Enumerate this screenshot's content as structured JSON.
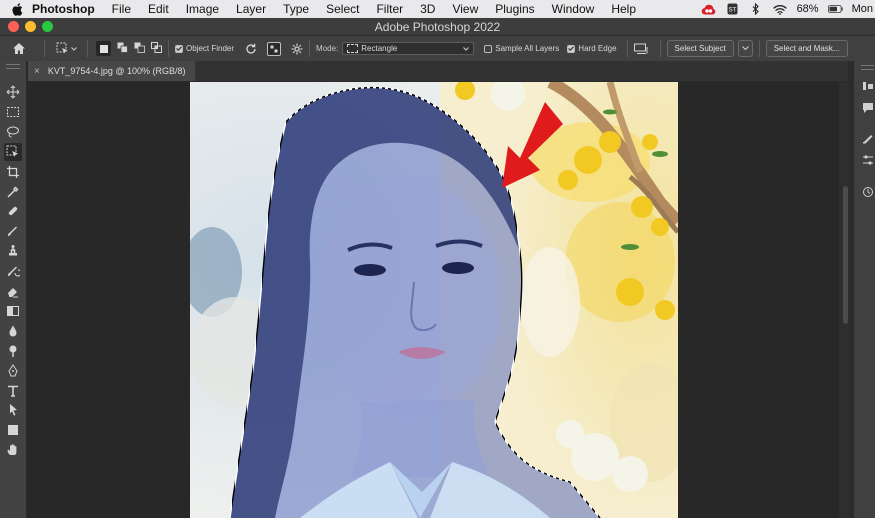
{
  "menubar": {
    "app": "Photoshop",
    "items": [
      "File",
      "Edit",
      "Image",
      "Layer",
      "Type",
      "Select",
      "Filter",
      "3D",
      "View",
      "Plugins",
      "Window",
      "Help"
    ],
    "battery": "68%",
    "clock": "Mon"
  },
  "window": {
    "title": "Adobe Photoshop 2022"
  },
  "options": {
    "object_finder": "Object Finder",
    "mode_label": "Mode:",
    "mode_value": "Rectangle",
    "sample_all_layers": "Sample All Layers",
    "hard_edge": "Hard Edge",
    "select_subject": "Select Subject",
    "select_and_mask": "Select and Mask..."
  },
  "document": {
    "tab_title": "KVT_9754-4.jpg @ 100% (RGB/8)"
  },
  "tools": [
    "move-icon",
    "marquee-icon",
    "lasso-icon",
    "object-selection-icon",
    "crop-icon",
    "eyedropper-icon",
    "healing-icon",
    "brush-icon",
    "clone-stamp-icon",
    "history-brush-icon",
    "eraser-icon",
    "gradient-icon",
    "blur-icon",
    "dodge-icon",
    "pen-icon",
    "type-icon",
    "path-selection-icon",
    "shape-icon",
    "hand-icon"
  ],
  "colors": {
    "accent_arrow": "#e01b1b",
    "overlay": "#5a6fbf"
  }
}
